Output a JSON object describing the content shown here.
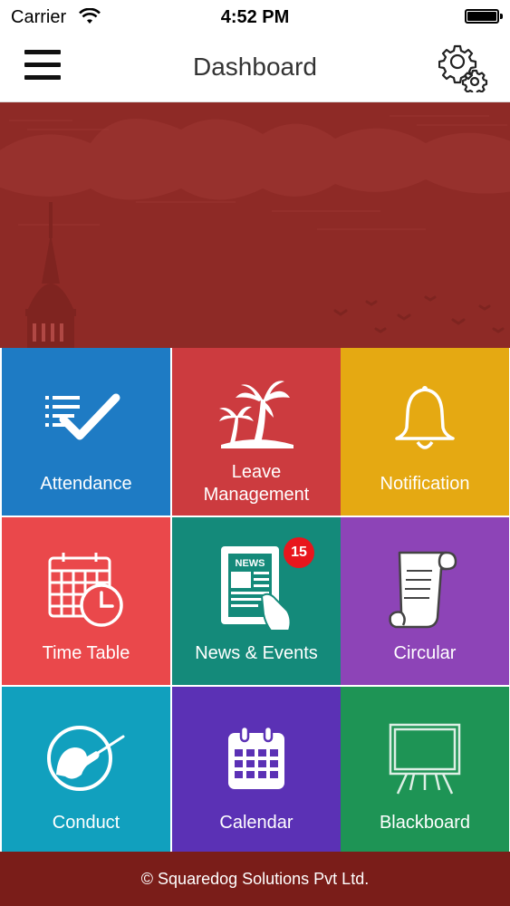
{
  "status_bar": {
    "carrier": "Carrier",
    "time": "4:52 PM"
  },
  "nav": {
    "title": "Dashboard",
    "menu_icon": "hamburger-menu-icon",
    "settings_icon": "gear-icon"
  },
  "colors": {
    "banner": "#8e2a26",
    "footer": "#7a1d19",
    "attendance": "#1e7bc4",
    "leave": "#cc3b3f",
    "notification": "#e5a912",
    "timetable": "#ea484b",
    "news": "#148a7a",
    "circular": "#8d44b7",
    "conduct": "#11a0be",
    "calendar": "#5b31b5",
    "blackboard": "#1e9455",
    "badge": "#e8161d"
  },
  "tiles": [
    {
      "label": "Attendance",
      "icon": "checklist-icon"
    },
    {
      "label": "Leave\nManagement",
      "icon": "palm-tree-icon"
    },
    {
      "label": "Notification",
      "icon": "bell-icon"
    },
    {
      "label": "Time Table",
      "icon": "calendar-clock-icon"
    },
    {
      "label": "News & Events",
      "icon": "newspaper-icon",
      "badge": "15",
      "news_text": "NEWS"
    },
    {
      "label": "Circular",
      "icon": "scroll-icon"
    },
    {
      "label": "Conduct",
      "icon": "conductor-icon"
    },
    {
      "label": "Calendar",
      "icon": "calendar-icon"
    },
    {
      "label": "Blackboard",
      "icon": "blackboard-icon"
    }
  ],
  "footer": {
    "text": "© Squaredog Solutions Pvt Ltd."
  }
}
